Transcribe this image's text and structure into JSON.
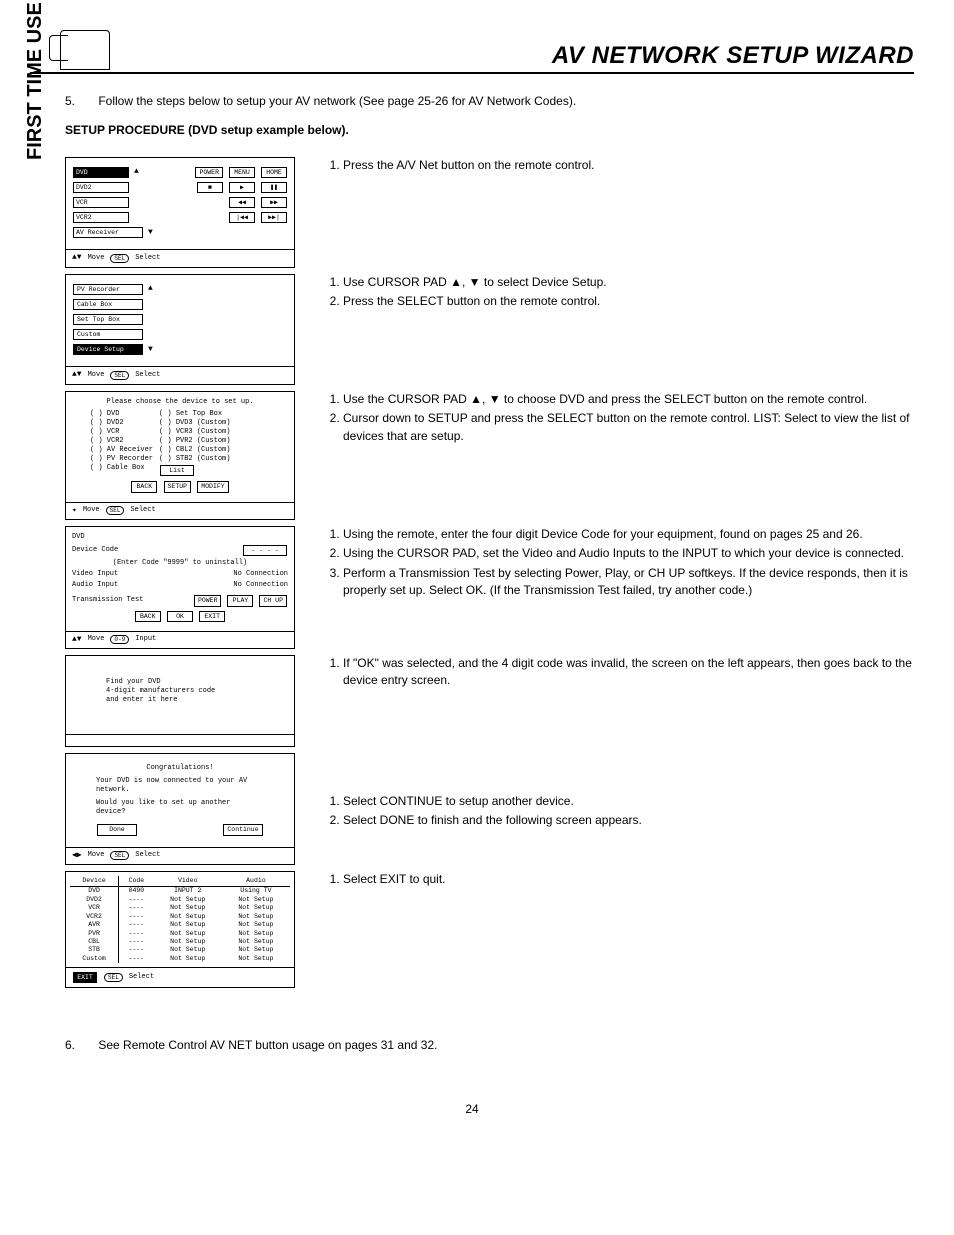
{
  "header": {
    "title": "AV NETWORK SETUP WIZARD"
  },
  "sidetab": "FIRST TIME USE",
  "intro": {
    "num": "5.",
    "text": "Follow the steps below to setup your AV network (See page 25-26 for AV Network Codes)."
  },
  "subhead": "SETUP PROCEDURE (DVD setup example below).",
  "panel1": {
    "items": [
      "DVD",
      "DVD2",
      "VCR",
      "VCR2",
      "AV Receiver"
    ],
    "btns_r1": [
      "POWER",
      "MENU",
      "HOME"
    ],
    "btns_r2": [
      "◀◀",
      "▶▶"
    ],
    "btns_r3": [
      "|◀◀",
      "▶▶|"
    ],
    "foot_left": "Move",
    "foot_sel": "SEL",
    "foot_right": "Select"
  },
  "instr1": {
    "i1": "Press the A/V Net button on the remote control."
  },
  "panel2": {
    "items": [
      "PV Recorder",
      "Cable Box",
      "Set Top Box",
      "Custom",
      "Device Setup"
    ],
    "foot_left": "Move",
    "foot_sel": "SEL",
    "foot_right": "Select"
  },
  "instr2": {
    "i1": "Use CURSOR PAD ▲, ▼ to select Device Setup.",
    "i2": "Press the SELECT button on the remote control."
  },
  "panel3": {
    "title": "Please choose the device to set up.",
    "left": [
      "( ) DVD",
      "( ) DVD2",
      "( ) VCR",
      "( ) VCR2",
      "( ) AV Receiver",
      "( ) PV Recorder",
      "( ) Cable Box"
    ],
    "right": [
      "( ) Set Top Box",
      "( ) DVD3 (Custom)",
      "( ) VCR3 (Custom)",
      "( ) PVR2 (Custom)",
      "( ) CBL2 (Custom)",
      "( ) STB2 (Custom)"
    ],
    "listbtn": "List",
    "btns": [
      "BACK",
      "SETUP",
      "MODIFY"
    ],
    "foot_left": "Move",
    "foot_sel": "SEL",
    "foot_right": "Select"
  },
  "instr3": {
    "i1": "Use the CURSOR PAD ▲, ▼ to choose DVD and press the SELECT button on the remote control.",
    "i2": "Cursor down to SETUP and press the SELECT button on the remote control. LIST:  Select to view the list of devices that are setup."
  },
  "panel4": {
    "l1": "DVD",
    "l2": "Device Code",
    "code": "- - - -",
    "hint": "(Enter Code \"9999\" to uninstall)",
    "vin": "Video Input",
    "vin_v": "No Connection",
    "ain": "Audio Input",
    "ain_v": "No Connection",
    "tt": "Transmission Test",
    "btns_top": [
      "POWER",
      "PLAY",
      "CH UP"
    ],
    "btns_bot": [
      "BACK",
      "OK",
      "EXIT"
    ],
    "foot_left": "Move",
    "foot_sel": "0-9",
    "foot_right": "Input"
  },
  "instr4": {
    "i1": "Using the remote, enter the four digit Device Code for your equipment, found on pages 25 and 26.",
    "i2": "Using the CURSOR PAD, set the Video and Audio Inputs to the INPUT to which your device is connected.",
    "i3": "Perform a Transmission Test by selecting Power, Play, or CH UP softkeys.  If the device responds, then it is properly set up.  Select OK.  (If the Transmission Test failed, try another code.)"
  },
  "panel5": {
    "l1": "Find your DVD",
    "l2": "4-digit manufacturers code",
    "l3": "and enter it here"
  },
  "instr5": {
    "i1": "If \"OK\" was selected, and the 4 digit code was invalid, the screen on the left appears, then goes back to the device entry screen."
  },
  "panel6": {
    "l1": "Congratulations!",
    "l2": "Your DVD is now connected to your AV network.",
    "l3": "Would you like to set up another device?",
    "btn1": "Done",
    "btn2": "Continue",
    "foot_left": "Move",
    "foot_sel": "SEL",
    "foot_right": "Select"
  },
  "instr6": {
    "i1": "Select CONTINUE to setup another device.",
    "i2": "Select DONE to finish and the following screen appears."
  },
  "panel7": {
    "headers": [
      "Device",
      "Code",
      "Video",
      "Audio"
    ],
    "rows": [
      [
        "DVD",
        "0490",
        "INPUT 2",
        "Using TV"
      ],
      [
        "DVD2",
        "----",
        "Not Setup",
        "Not Setup"
      ],
      [
        "VCR",
        "----",
        "Not Setup",
        "Not Setup"
      ],
      [
        "VCR2",
        "----",
        "Not Setup",
        "Not Setup"
      ],
      [
        "AVR",
        "----",
        "Not Setup",
        "Not Setup"
      ],
      [
        "PVR",
        "----",
        "Not Setup",
        "Not Setup"
      ],
      [
        "CBL",
        "----",
        "Not Setup",
        "Not Setup"
      ],
      [
        "STB",
        "----",
        "Not Setup",
        "Not Setup"
      ],
      [
        "Custom",
        "----",
        "Not Setup",
        "Not Setup"
      ]
    ],
    "exit": "EXIT",
    "foot_sel": "SEL",
    "foot_right": "Select"
  },
  "instr7": {
    "i1": "Select EXIT to quit."
  },
  "outro": {
    "num": "6.",
    "text": "See Remote Control AV NET button usage on pages 31 and 32."
  },
  "pagenum": "24"
}
